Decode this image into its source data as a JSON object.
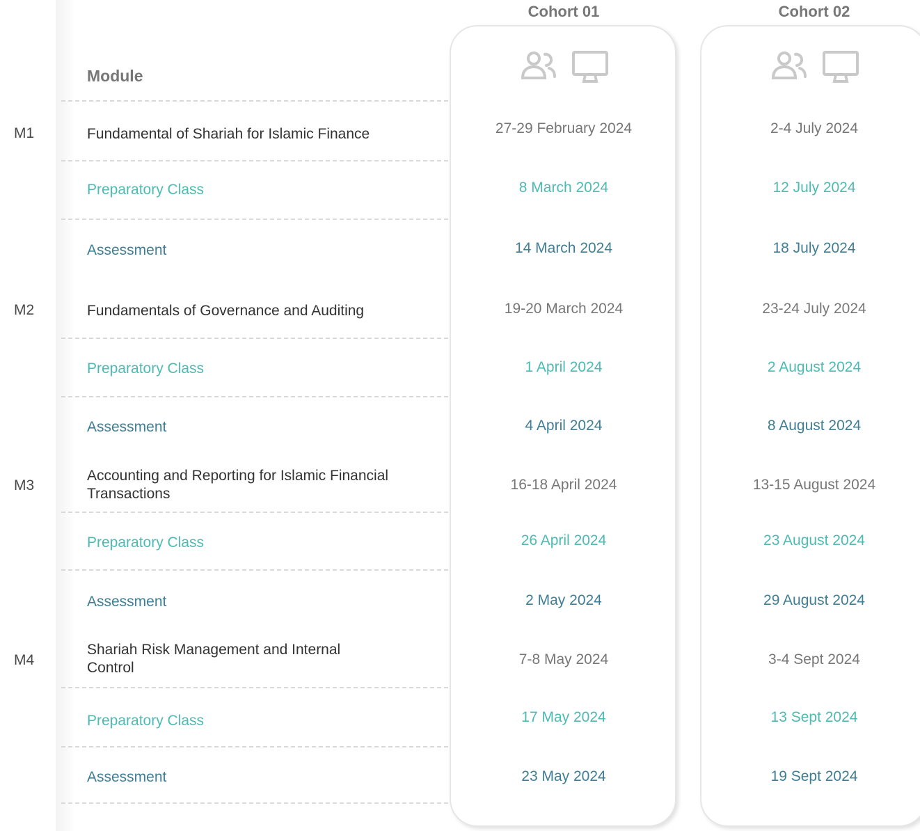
{
  "header": {
    "module_label": "Module",
    "cohorts": [
      "Cohort 01",
      "Cohort 02"
    ]
  },
  "icons": [
    "group-icon",
    "monitor-icon"
  ],
  "colors": {
    "main": "#777777",
    "preparatory": "#4dbab3",
    "assessment": "#3f7e94",
    "border": "#e6e6e6"
  },
  "modules": [
    {
      "code": "M1",
      "title": "Fundamental of Shariah for Islamic Finance",
      "main_dates": [
        "27-29 February 2024",
        "2-4 July 2024"
      ],
      "prep_label": "Preparatory Class",
      "prep_dates": [
        "8 March  2024",
        "12 July 2024"
      ],
      "assess_label": "Assessment",
      "assess_dates": [
        "14 March 2024",
        "18 July 2024"
      ]
    },
    {
      "code": "M2",
      "title": "Fundamentals of Governance and Auditing",
      "main_dates": [
        "19-20 March  2024",
        "23-24 July 2024"
      ],
      "prep_label": "Preparatory Class",
      "prep_dates": [
        "1 April 2024",
        "2 August 2024"
      ],
      "assess_label": "Assessment",
      "assess_dates": [
        "4 April 2024",
        "8 August 2024"
      ]
    },
    {
      "code": "M3",
      "title_lines": [
        "Accounting and Reporting for Islamic Financial",
        "Transactions"
      ],
      "main_dates": [
        "16-18 April 2024",
        "13-15 August 2024"
      ],
      "prep_label": "Preparatory Class",
      "prep_dates": [
        "26 April 2024",
        "23 August 2024"
      ],
      "assess_label": "Assessment",
      "assess_dates": [
        "2 May  2024",
        "29 August 2024"
      ]
    },
    {
      "code": "M4",
      "title_lines": [
        "Shariah Risk Management and Internal",
        "Control"
      ],
      "main_dates": [
        "7-8 May  2024",
        "3-4 Sept 2024"
      ],
      "prep_label": "Preparatory Class",
      "prep_dates": [
        "17 May  2024",
        "13 Sept 2024"
      ],
      "assess_label": "Assessment",
      "assess_dates": [
        "23 May  2024",
        "19 Sept 2024"
      ]
    }
  ]
}
